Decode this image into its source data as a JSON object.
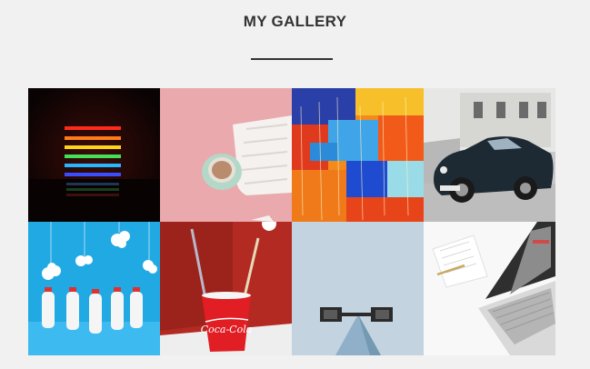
{
  "gallery": {
    "title": "MY GALLERY",
    "items": [
      {
        "subject": "neon-light-bars"
      },
      {
        "subject": "coffee-cup-and-sweater"
      },
      {
        "subject": "abstract-painting"
      },
      {
        "subject": "vintage-car"
      },
      {
        "subject": "milk-bottles-and-clouds"
      },
      {
        "subject": "coca-cola-cup",
        "label": "Coca-Cola"
      },
      {
        "subject": "abstract-shape"
      },
      {
        "subject": "laptop-on-desk"
      }
    ]
  }
}
